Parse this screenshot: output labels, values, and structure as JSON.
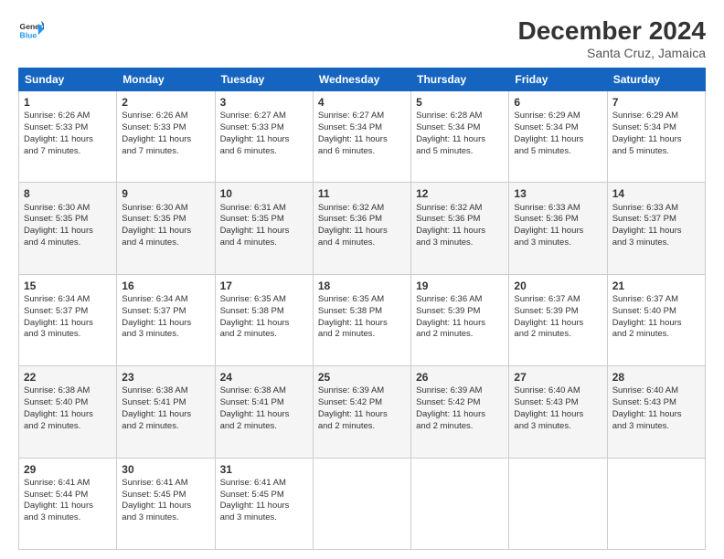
{
  "logo": {
    "line1": "General",
    "line2": "Blue"
  },
  "title": "December 2024",
  "subtitle": "Santa Cruz, Jamaica",
  "days_of_week": [
    "Sunday",
    "Monday",
    "Tuesday",
    "Wednesday",
    "Thursday",
    "Friday",
    "Saturday"
  ],
  "weeks": [
    [
      {
        "day": 1,
        "lines": [
          "Sunrise: 6:26 AM",
          "Sunset: 5:33 PM",
          "Daylight: 11 hours",
          "and 7 minutes."
        ]
      },
      {
        "day": 2,
        "lines": [
          "Sunrise: 6:26 AM",
          "Sunset: 5:33 PM",
          "Daylight: 11 hours",
          "and 7 minutes."
        ]
      },
      {
        "day": 3,
        "lines": [
          "Sunrise: 6:27 AM",
          "Sunset: 5:33 PM",
          "Daylight: 11 hours",
          "and 6 minutes."
        ]
      },
      {
        "day": 4,
        "lines": [
          "Sunrise: 6:27 AM",
          "Sunset: 5:34 PM",
          "Daylight: 11 hours",
          "and 6 minutes."
        ]
      },
      {
        "day": 5,
        "lines": [
          "Sunrise: 6:28 AM",
          "Sunset: 5:34 PM",
          "Daylight: 11 hours",
          "and 5 minutes."
        ]
      },
      {
        "day": 6,
        "lines": [
          "Sunrise: 6:29 AM",
          "Sunset: 5:34 PM",
          "Daylight: 11 hours",
          "and 5 minutes."
        ]
      },
      {
        "day": 7,
        "lines": [
          "Sunrise: 6:29 AM",
          "Sunset: 5:34 PM",
          "Daylight: 11 hours",
          "and 5 minutes."
        ]
      }
    ],
    [
      {
        "day": 8,
        "lines": [
          "Sunrise: 6:30 AM",
          "Sunset: 5:35 PM",
          "Daylight: 11 hours",
          "and 4 minutes."
        ]
      },
      {
        "day": 9,
        "lines": [
          "Sunrise: 6:30 AM",
          "Sunset: 5:35 PM",
          "Daylight: 11 hours",
          "and 4 minutes."
        ]
      },
      {
        "day": 10,
        "lines": [
          "Sunrise: 6:31 AM",
          "Sunset: 5:35 PM",
          "Daylight: 11 hours",
          "and 4 minutes."
        ]
      },
      {
        "day": 11,
        "lines": [
          "Sunrise: 6:32 AM",
          "Sunset: 5:36 PM",
          "Daylight: 11 hours",
          "and 4 minutes."
        ]
      },
      {
        "day": 12,
        "lines": [
          "Sunrise: 6:32 AM",
          "Sunset: 5:36 PM",
          "Daylight: 11 hours",
          "and 3 minutes."
        ]
      },
      {
        "day": 13,
        "lines": [
          "Sunrise: 6:33 AM",
          "Sunset: 5:36 PM",
          "Daylight: 11 hours",
          "and 3 minutes."
        ]
      },
      {
        "day": 14,
        "lines": [
          "Sunrise: 6:33 AM",
          "Sunset: 5:37 PM",
          "Daylight: 11 hours",
          "and 3 minutes."
        ]
      }
    ],
    [
      {
        "day": 15,
        "lines": [
          "Sunrise: 6:34 AM",
          "Sunset: 5:37 PM",
          "Daylight: 11 hours",
          "and 3 minutes."
        ]
      },
      {
        "day": 16,
        "lines": [
          "Sunrise: 6:34 AM",
          "Sunset: 5:37 PM",
          "Daylight: 11 hours",
          "and 3 minutes."
        ]
      },
      {
        "day": 17,
        "lines": [
          "Sunrise: 6:35 AM",
          "Sunset: 5:38 PM",
          "Daylight: 11 hours",
          "and 2 minutes."
        ]
      },
      {
        "day": 18,
        "lines": [
          "Sunrise: 6:35 AM",
          "Sunset: 5:38 PM",
          "Daylight: 11 hours",
          "and 2 minutes."
        ]
      },
      {
        "day": 19,
        "lines": [
          "Sunrise: 6:36 AM",
          "Sunset: 5:39 PM",
          "Daylight: 11 hours",
          "and 2 minutes."
        ]
      },
      {
        "day": 20,
        "lines": [
          "Sunrise: 6:37 AM",
          "Sunset: 5:39 PM",
          "Daylight: 11 hours",
          "and 2 minutes."
        ]
      },
      {
        "day": 21,
        "lines": [
          "Sunrise: 6:37 AM",
          "Sunset: 5:40 PM",
          "Daylight: 11 hours",
          "and 2 minutes."
        ]
      }
    ],
    [
      {
        "day": 22,
        "lines": [
          "Sunrise: 6:38 AM",
          "Sunset: 5:40 PM",
          "Daylight: 11 hours",
          "and 2 minutes."
        ]
      },
      {
        "day": 23,
        "lines": [
          "Sunrise: 6:38 AM",
          "Sunset: 5:41 PM",
          "Daylight: 11 hours",
          "and 2 minutes."
        ]
      },
      {
        "day": 24,
        "lines": [
          "Sunrise: 6:38 AM",
          "Sunset: 5:41 PM",
          "Daylight: 11 hours",
          "and 2 minutes."
        ]
      },
      {
        "day": 25,
        "lines": [
          "Sunrise: 6:39 AM",
          "Sunset: 5:42 PM",
          "Daylight: 11 hours",
          "and 2 minutes."
        ]
      },
      {
        "day": 26,
        "lines": [
          "Sunrise: 6:39 AM",
          "Sunset: 5:42 PM",
          "Daylight: 11 hours",
          "and 2 minutes."
        ]
      },
      {
        "day": 27,
        "lines": [
          "Sunrise: 6:40 AM",
          "Sunset: 5:43 PM",
          "Daylight: 11 hours",
          "and 3 minutes."
        ]
      },
      {
        "day": 28,
        "lines": [
          "Sunrise: 6:40 AM",
          "Sunset: 5:43 PM",
          "Daylight: 11 hours",
          "and 3 minutes."
        ]
      }
    ],
    [
      {
        "day": 29,
        "lines": [
          "Sunrise: 6:41 AM",
          "Sunset: 5:44 PM",
          "Daylight: 11 hours",
          "and 3 minutes."
        ]
      },
      {
        "day": 30,
        "lines": [
          "Sunrise: 6:41 AM",
          "Sunset: 5:45 PM",
          "Daylight: 11 hours",
          "and 3 minutes."
        ]
      },
      {
        "day": 31,
        "lines": [
          "Sunrise: 6:41 AM",
          "Sunset: 5:45 PM",
          "Daylight: 11 hours",
          "and 3 minutes."
        ]
      },
      null,
      null,
      null,
      null
    ]
  ]
}
